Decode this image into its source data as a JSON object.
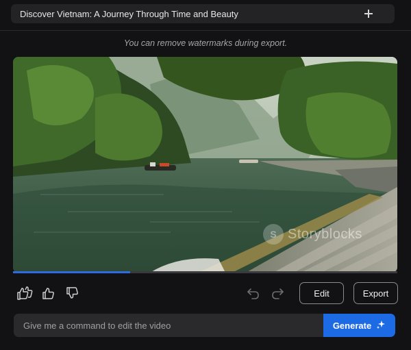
{
  "header": {
    "title": "Discover Vietnam: A Journey Through Time and Beauty",
    "add_icon": "plus-icon"
  },
  "notice": "You can remove watermarks during export.",
  "video": {
    "watermark_text": "Storyblocks",
    "watermark_logo": "S",
    "progress": 0.305
  },
  "actions": {
    "like_all_icon": "double-thumbs-up-icon",
    "like_icon": "thumbs-up-icon",
    "dislike_icon": "thumbs-down-icon",
    "undo_icon": "undo-icon",
    "redo_icon": "redo-icon",
    "edit_label": "Edit",
    "export_label": "Export"
  },
  "command": {
    "placeholder": "Give me a command to edit the video",
    "value": "",
    "generate_label": "Generate",
    "generate_icon": "sparkle-icon"
  },
  "colors": {
    "accent": "#1d6ae5",
    "progress": "#2f6be0",
    "background": "#121214"
  }
}
